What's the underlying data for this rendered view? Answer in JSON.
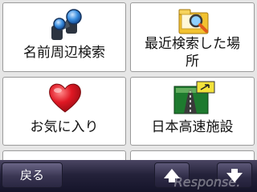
{
  "menu": {
    "tiles": [
      {
        "label": "名前周辺検索",
        "icon": "binoculars-icon"
      },
      {
        "label": "最近検索した場\n所",
        "icon": "folder-search-icon"
      },
      {
        "label": "お気に入り",
        "icon": "heart-icon"
      },
      {
        "label": "日本高速施設",
        "icon": "highway-road-icon"
      }
    ]
  },
  "bottom_bar": {
    "back_label": "戻る",
    "scroll_up_icon": "arrow-up-icon",
    "scroll_down_icon": "arrow-down-icon"
  },
  "watermark": {
    "text": "Response."
  },
  "colors": {
    "bar": "#24223a",
    "heart": "#d8131f",
    "tile_border": "#9a9a9a"
  }
}
